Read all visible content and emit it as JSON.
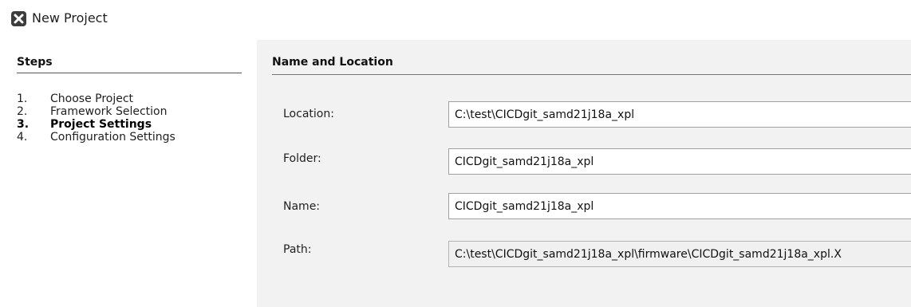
{
  "window": {
    "title": "New Project"
  },
  "steps": {
    "heading": "Steps",
    "items": [
      {
        "number": "1.",
        "label": "Choose Project"
      },
      {
        "number": "2.",
        "label": "Framework Selection"
      },
      {
        "number": "3.",
        "label": "Project Settings"
      },
      {
        "number": "4.",
        "label": "Configuration Settings"
      }
    ]
  },
  "section": {
    "heading": "Name and Location"
  },
  "form": {
    "location": {
      "label": "Location:",
      "value": "C:\\test\\CICDgit_samd21j18a_xpl"
    },
    "folder": {
      "label": "Folder:",
      "value": "CICDgit_samd21j18a_xpl"
    },
    "name": {
      "label": "Name:",
      "value": "CICDgit_samd21j18a_xpl"
    },
    "path": {
      "label": "Path:",
      "value": "C:\\test\\CICDgit_samd21j18a_xpl\\firmware\\CICDgit_samd21j18a_xpl.X"
    }
  }
}
